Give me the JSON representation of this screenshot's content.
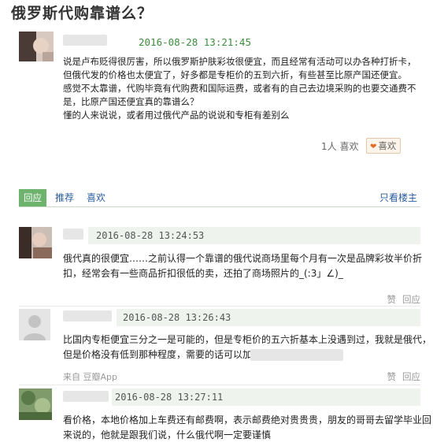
{
  "post": {
    "title": "俄罗斯代购靠谱么？",
    "time": "2016-08-28 13:21:45",
    "lines": [
      "说是卢布贬得很厉害，所以俄罗斯护肤彩妆很便宜，而且经常有活动可以办各种打折卡，",
      "但俄代发的价格也太便宜了，好多都是专柜价的五到六折，有些甚至比原产国还便宜。",
      "感觉不太靠谱，代购毕竟有代购费和国际运费，或者有的自己去边境采购的也要交通费不",
      "是，比原产国还便宜真的靠谱么？",
      "懂的人来说说，或者用过俄代产品的说说和专柜有差别么"
    ],
    "like_count": "1人 喜欢",
    "like_button": "喜欢"
  },
  "actionbar": {
    "reply": "回应",
    "recommend": "推荐",
    "like": "喜欢",
    "only_op": "只看楼主"
  },
  "comments": [
    {
      "time": "2016-08-28 13:24:53",
      "lines": [
        "俄代真的很便宜……之前认得一个靠谱的俄代说商场里每个月有一次是品牌彩妆半价折",
        "扣，经常会有一些商品折扣很低的卖，还拍了商场照片的_(:3」∠)_"
      ],
      "ops": [
        "赞",
        "回应"
      ]
    },
    {
      "time": "2016-08-28 13:26:43",
      "lines": [
        "比国内专柜便宜三分之一是可能的，但是专柜价的五六折基本上没遇到过，我就是俄代，",
        "但是价格没有低到那种程度，需要的话可以加微"
      ],
      "source": "来自 豆瓣App",
      "ops": [
        "赞",
        "回应"
      ]
    },
    {
      "time": "2016-08-28 13:27:11",
      "lines": [
        "看价格，本地价格加上车费还有邮费啊，表示邮费绝对贵贵贵，朋友的哥哥去留学毕业回",
        "来说的，他就是跟我们说，什么俄代啊一定要谨慎"
      ]
    }
  ],
  "colors": {
    "accent_green": "#6db36d",
    "link_blue": "#2a5c9e",
    "time_green": "#3c8d3c"
  }
}
